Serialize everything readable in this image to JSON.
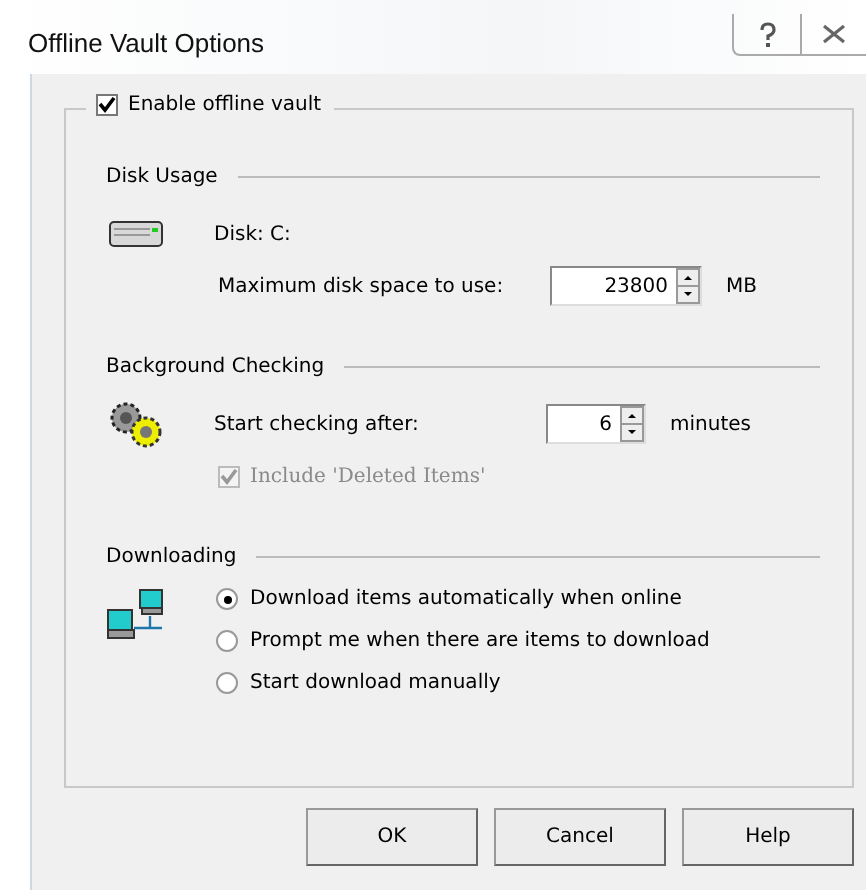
{
  "window": {
    "title": "Offline Vault Options"
  },
  "enable_vault": {
    "label": "Enable offline vault",
    "checked": true
  },
  "disk_usage": {
    "title": "Disk Usage",
    "disk": "Disk: C:",
    "max_label": "Maximum disk space to use:",
    "value": "23800",
    "unit": "MB"
  },
  "background_checking": {
    "title": "Background Checking",
    "start_label": "Start checking after:",
    "value": "6",
    "unit": "minutes",
    "include_deleted": {
      "label": "Include 'Deleted Items'",
      "checked": true,
      "disabled": true
    }
  },
  "downloading": {
    "title": "Downloading",
    "options": [
      {
        "label": "Download items automatically when online",
        "selected": true
      },
      {
        "label": "Prompt me when there are items to download",
        "selected": false
      },
      {
        "label": "Start download manually",
        "selected": false
      }
    ]
  },
  "buttons": [
    "OK",
    "Cancel",
    "Help"
  ]
}
